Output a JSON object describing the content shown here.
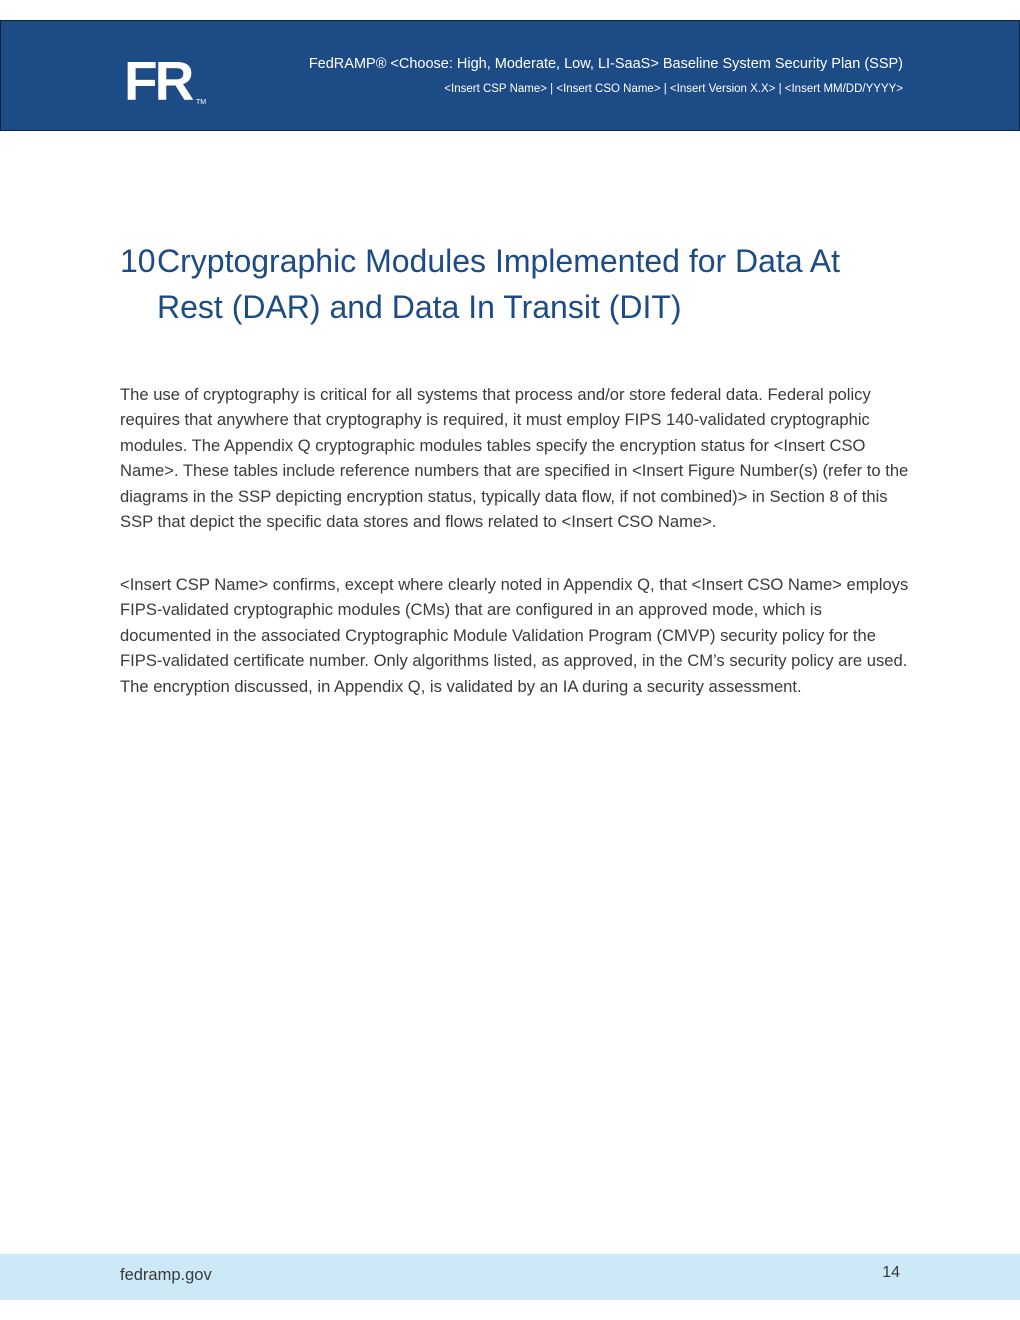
{
  "header": {
    "title": "FedRAMP® <Choose: High, Moderate, Low, LI-SaaS> Baseline System Security Plan (SSP)",
    "subtitle": "<Insert CSP Name> | <Insert CSO Name> | <Insert Version X.X> | <Insert MM/DD/YYYY>",
    "logo_text": "FR",
    "logo_tm": "TM",
    "background_color": "#1c4b86"
  },
  "section": {
    "number": "10",
    "title_line1": "Cryptographic Modules Implemented for Data At",
    "title_line2": "Rest (DAR) and Data In Transit (DIT)",
    "heading_color": "#1c4b86"
  },
  "paragraphs": [
    "The use of cryptography is critical for all systems that process and/or store federal data. Federal policy requires that anywhere that cryptography is required, it must employ FIPS 140-validated cryptographic modules. The Appendix Q cryptographic modules tables specify the encryption status for <Insert CSO Name>. These tables include reference numbers that are specified in <Insert Figure Number(s) (refer to the diagrams in the SSP depicting encryption status, typically data flow, if not combined)> in Section 8 of this SSP that depict the specific data stores and flows related to <Insert CSO Name>.",
    " <Insert CSP Name> confirms, except where clearly noted in Appendix Q, that <Insert CSO Name> employs FIPS-validated cryptographic modules (CMs) that are configured in an approved mode, which is documented in the associated Cryptographic Module Validation Program (CMVP) security policy for the FIPS-validated certificate number. Only algorithms listed, as approved, in the CM’s security policy are used. The encryption discussed, in Appendix Q, is validated by an IA during a security assessment."
  ],
  "footer": {
    "site": "fedramp.gov",
    "page_number": "14",
    "background_color": "#cde8f7"
  }
}
